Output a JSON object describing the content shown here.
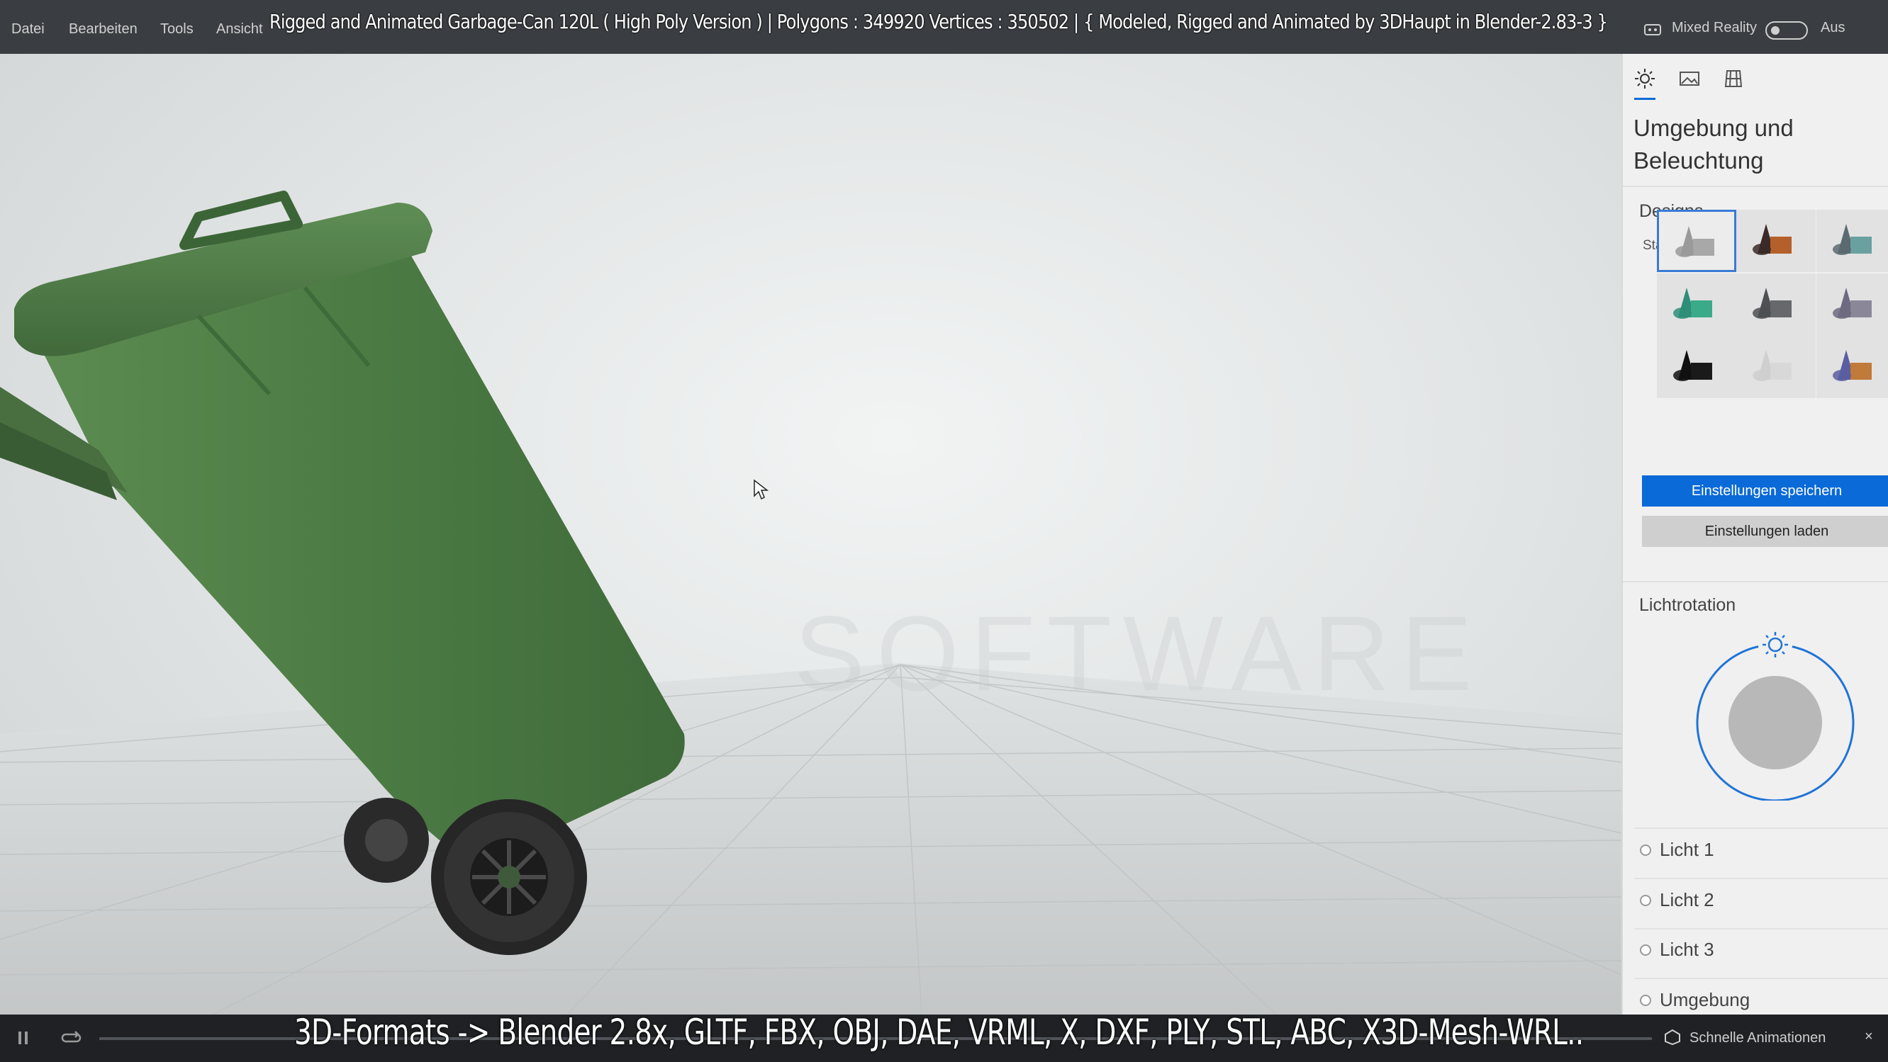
{
  "menubar": {
    "items": [
      "Datei",
      "Bearbeiten",
      "Tools",
      "Ansicht"
    ],
    "mixed_reality_label": "Mixed Reality",
    "toggle_state": "Aus"
  },
  "overlay": {
    "title": "Rigged and Animated Garbage-Can 120L ( High Poly Version ) |  Polygons : 349920  Vertices : 350502   |   { Modeled, Rigged and Animated by 3DHaupt in Blender-2.83-3 }",
    "footer": "3D-Formats -> Blender 2.8x, GLTF, FBX, OBJ, DAE, VRML, X, DXF, PLY, STL, ABC, X3D-Mesh-WRL.."
  },
  "viewport": {
    "watermark": "SOFTWARE"
  },
  "panel": {
    "tabs": [
      "sun-icon",
      "image-icon",
      "grid-icon"
    ],
    "title": "Umgebung und Beleuchtung",
    "designs_heading": "Designs",
    "standard_label": "Standard",
    "swatches": [
      {
        "name": "grey",
        "cone": "#9a9a9a",
        "box": "#a8a8a8"
      },
      {
        "name": "dark-orange",
        "cone": "#3a2a28",
        "box": "#b4602a"
      },
      {
        "name": "teal-grey",
        "cone": "#5a6a70",
        "box": "#6aa0a0"
      },
      {
        "name": "green",
        "cone": "#2e8e78",
        "box": "#3aaa88"
      },
      {
        "name": "dark-grey",
        "cone": "#4e5054",
        "box": "#66686c"
      },
      {
        "name": "purple-grey",
        "cone": "#6e6a80",
        "box": "#8a8898"
      },
      {
        "name": "black",
        "cone": "#111111",
        "box": "#1a1a1a"
      },
      {
        "name": "light",
        "cone": "#cfcfcf",
        "box": "#d8d8d8"
      },
      {
        "name": "purple-orange",
        "cone": "#5a5ea0",
        "box": "#c07a3a"
      }
    ],
    "save_button": "Einstellungen speichern",
    "load_button": "Einstellungen laden",
    "light_rotation_heading": "Lichtrotation",
    "lights": [
      "Licht 1",
      "Licht 2",
      "Licht 3",
      "Umgebung"
    ]
  },
  "bottombar": {
    "quick_animations": "Schnelle Animationen"
  },
  "colors": {
    "accent": "#0a6ad8",
    "bin_green": "#4a7a42",
    "panel_bg": "#f0f0f0"
  }
}
